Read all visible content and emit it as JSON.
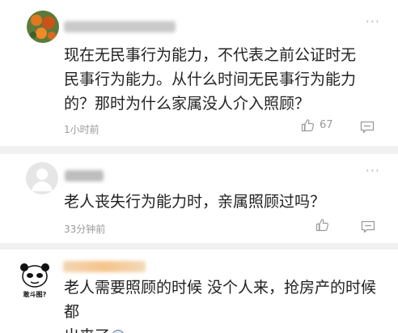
{
  "comments": [
    {
      "text": "现在无民事行为能力，不代表之前公证时无\n民事行为能力。从什么时间无民事行为能力\n的？那时为什么家属没人介入照顾？",
      "time": "1小时前",
      "likes": "67"
    },
    {
      "text": "老人丧失行为能力时，亲属照顾过吗？",
      "time": "33分钟前",
      "likes": ""
    },
    {
      "text": "老人需要照顾的时候 没个人来，抢房产的时候都\n出来了",
      "avatar_caption": "敢斗图?"
    }
  ],
  "icons": {
    "more": "more-icon",
    "like": "thumbs-up-icon",
    "reply": "reply-icon",
    "emoji": "emoji-icon"
  },
  "colors": {
    "divider": "#f1f1f1",
    "meta_text": "#9a9a9a",
    "body_text": "#222222"
  }
}
